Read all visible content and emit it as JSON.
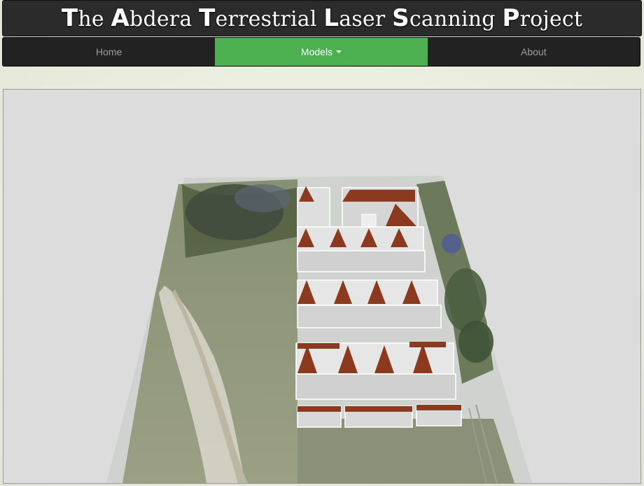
{
  "header": {
    "title": "The Abdera Terrestrial Laser Scanning Project",
    "title_parts": [
      {
        "cap": "T",
        "rest": "he"
      },
      {
        "cap": "A",
        "rest": "bdera"
      },
      {
        "cap": "T",
        "rest": "errestrial"
      },
      {
        "cap": "L",
        "rest": "aser"
      },
      {
        "cap": "S",
        "rest": "canning"
      },
      {
        "cap": "P",
        "rest": "roject"
      }
    ]
  },
  "nav": {
    "items": [
      {
        "label": "Home",
        "active": false,
        "dropdown": false
      },
      {
        "label": "Models",
        "active": true,
        "dropdown": true
      },
      {
        "label": "About",
        "active": false,
        "dropdown": false
      }
    ],
    "active_color": "#4caf50",
    "dropdown_icon": "caret-down-icon"
  },
  "viewer": {
    "background_color": "#dcdcdc",
    "roof_color": "#8b3a1f",
    "wall_color": "#e4e4e4"
  }
}
